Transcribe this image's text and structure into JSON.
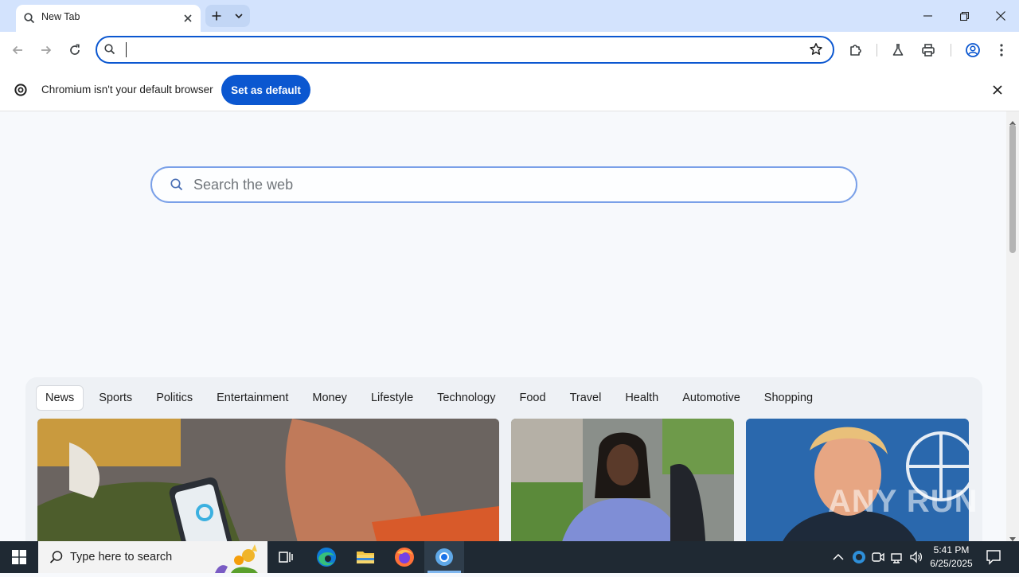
{
  "window": {
    "tab_title": "New Tab"
  },
  "toolbar": {
    "omnibox_value": ""
  },
  "infobar": {
    "message": "Chromium isn't your default browser",
    "button_label": "Set as default"
  },
  "newtab": {
    "search_placeholder": "Search the web",
    "categories": [
      "News",
      "Sports",
      "Politics",
      "Entertainment",
      "Money",
      "Lifestyle",
      "Technology",
      "Food",
      "Travel",
      "Health",
      "Automotive",
      "Shopping"
    ],
    "active_category": "News"
  },
  "taskbar": {
    "search_placeholder": "Type here to search",
    "time": "5:41 PM",
    "date": "6/25/2025"
  },
  "watermark": "ANY RUN",
  "colors": {
    "accent": "#0b57d0",
    "titlebar": "#d3e3fd",
    "taskbar": "#1f2933"
  }
}
